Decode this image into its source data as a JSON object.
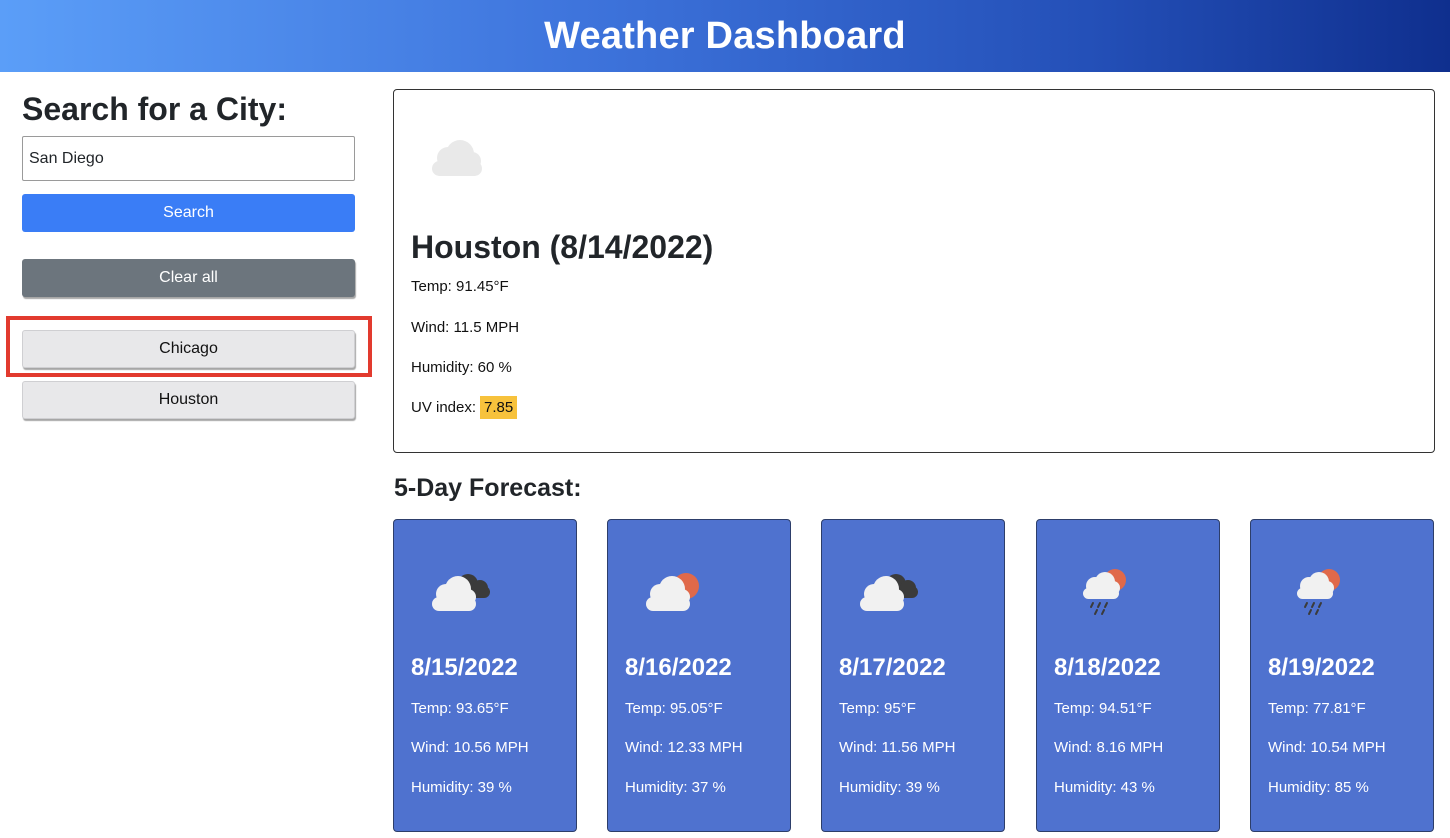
{
  "header": {
    "title": "Weather Dashboard"
  },
  "sidebar": {
    "heading": "Search for a City:",
    "search_value": "San Diego",
    "search_button": "Search",
    "clear_button": "Clear all",
    "cities": [
      "Chicago",
      "Houston"
    ]
  },
  "current": {
    "icon": "cloud-icon",
    "title": "Houston (8/14/2022)",
    "temp": "Temp: 91.45°F",
    "wind": "Wind: 11.5 MPH",
    "humidity": "Humidity: 60 %",
    "uv_label": "UV index:",
    "uv_value": "7.85",
    "uv_color": "#f7c23c"
  },
  "forecast": {
    "title": "5-Day Forecast:",
    "days": [
      {
        "date": "8/15/2022",
        "icon": "broken-clouds-icon",
        "temp": "Temp: 93.65°F",
        "wind": "Wind: 10.56 MPH",
        "humidity": "Humidity: 39 %"
      },
      {
        "date": "8/16/2022",
        "icon": "few-clouds-icon",
        "temp": "Temp: 95.05°F",
        "wind": "Wind: 12.33 MPH",
        "humidity": "Humidity: 37 %"
      },
      {
        "date": "8/17/2022",
        "icon": "broken-clouds-icon",
        "temp": "Temp: 95°F",
        "wind": "Wind: 11.56 MPH",
        "humidity": "Humidity: 39 %"
      },
      {
        "date": "8/18/2022",
        "icon": "rain-icon",
        "temp": "Temp: 94.51°F",
        "wind": "Wind: 8.16 MPH",
        "humidity": "Humidity: 43 %"
      },
      {
        "date": "8/19/2022",
        "icon": "rain-icon",
        "temp": "Temp: 77.81°F",
        "wind": "Wind: 10.54 MPH",
        "humidity": "Humidity: 85 %"
      }
    ]
  },
  "colors": {
    "accent": "#3a7df6",
    "card_bg": "#4f72cf",
    "highlight": "#e23a2e"
  }
}
